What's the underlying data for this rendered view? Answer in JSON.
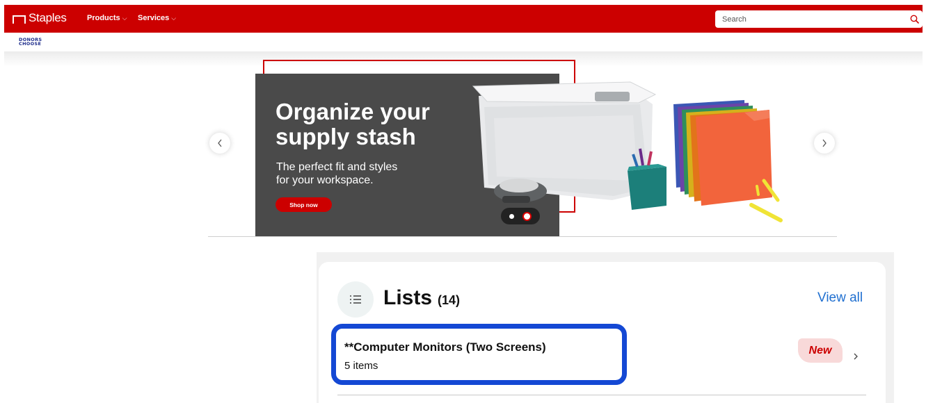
{
  "header": {
    "logo_text": "Staples",
    "nav": [
      {
        "label": "Products"
      },
      {
        "label": "Services"
      }
    ],
    "search_placeholder": "Search"
  },
  "partner": {
    "line1": "DONORS",
    "line2": "CHOOSE"
  },
  "hero": {
    "title_line1": "Organize your",
    "title_line2": "supply stash",
    "subtitle_line1": "The perfect fit and styles",
    "subtitle_line2": "for your workspace.",
    "cta_label": "Shop now",
    "slide_count": 2,
    "active_slide": 2
  },
  "lists": {
    "title": "Lists",
    "count": "(14)",
    "view_all_label": "View all",
    "items": [
      {
        "name": "**Computer Monitors (Two Screens)",
        "count": "5 items",
        "badge": "New"
      }
    ]
  },
  "colors": {
    "brand_red": "#cc0000",
    "link_blue": "#1f6fd0",
    "focus_blue": "#1448d4",
    "hero_gray": "#4a4a4a"
  }
}
